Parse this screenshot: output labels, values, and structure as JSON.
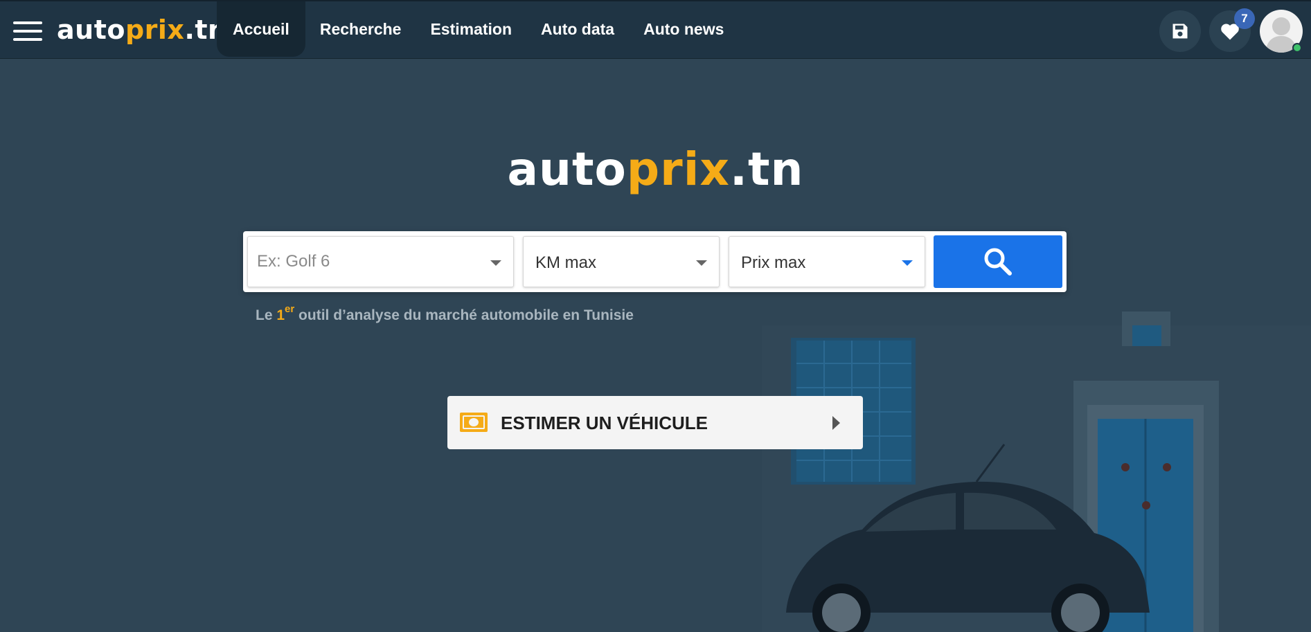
{
  "header": {
    "logo": {
      "part1": "auto",
      "part2": "prix",
      "part3": ".tn"
    },
    "nav": [
      {
        "label": "Accueil",
        "active": true
      },
      {
        "label": "Recherche",
        "active": false
      },
      {
        "label": "Estimation",
        "active": false
      },
      {
        "label": "Auto data",
        "active": false
      },
      {
        "label": "Auto news",
        "active": false
      }
    ],
    "favorites_count": "7",
    "icons": {
      "menu": "hamburger-icon",
      "save": "floppy-disk-icon",
      "favorites": "heart-icon",
      "avatar": "user-avatar"
    }
  },
  "hero": {
    "logo": {
      "part1": "auto",
      "part2": "prix",
      "part3": ".tn"
    },
    "search": {
      "model_placeholder": "Ex: Golf 6",
      "km_label": "KM max",
      "price_label": "Prix max",
      "button_icon": "search-icon"
    },
    "tagline": {
      "prefix": "Le ",
      "number": "1",
      "superscript": "er",
      "suffix": " outil d’analyse du marché automobile en Tunisie"
    },
    "estimate_button": {
      "label": "ESTIMER UN VÉHICULE",
      "icon": "banknote-icon"
    }
  },
  "colors": {
    "brand_accent": "#f5ab17",
    "header_bg": "#1f3444",
    "page_bg": "#2f4555",
    "search_button": "#1a73e8",
    "online_status": "#3fc26a",
    "badge": "#3a67b7"
  }
}
